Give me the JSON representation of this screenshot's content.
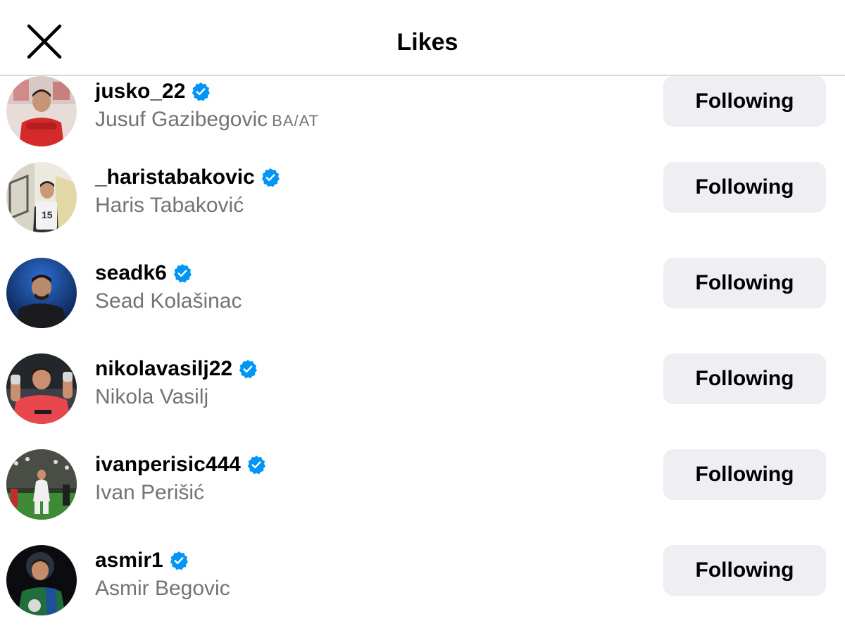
{
  "header": {
    "title": "Likes",
    "close_icon": "close-icon"
  },
  "colors": {
    "verified_badge": "#0095f6",
    "button_bg": "#efeff3",
    "secondary_text": "#737373",
    "divider": "#dbdbdb"
  },
  "users": [
    {
      "username": "jusko_22",
      "full_name": "Jusuf Gazibegovic",
      "full_name_tag": "BA/AT",
      "verified": true,
      "button_label": "Following",
      "avatar_icon": "avatar-player-red-kit"
    },
    {
      "username": "_haristabakovic",
      "full_name": "Haris Tabaković",
      "full_name_tag": "",
      "verified": true,
      "button_label": "Following",
      "avatar_icon": "avatar-player-holding-jersey"
    },
    {
      "username": "seadk6",
      "full_name": "Sead Kolašinac",
      "full_name_tag": "",
      "verified": true,
      "button_label": "Following",
      "avatar_icon": "avatar-player-blue-background"
    },
    {
      "username": "nikolavasilj22",
      "full_name": "Nikola Vasilj",
      "full_name_tag": "",
      "verified": true,
      "button_label": "Following",
      "avatar_icon": "avatar-goalkeeper-applauding"
    },
    {
      "username": "ivanperisic444",
      "full_name": "Ivan Perišić",
      "full_name_tag": "",
      "verified": true,
      "button_label": "Following",
      "avatar_icon": "avatar-player-on-pitch"
    },
    {
      "username": "asmir1",
      "full_name": "Asmir Begovic",
      "full_name_tag": "",
      "verified": true,
      "button_label": "Following",
      "avatar_icon": "avatar-goalkeeper-dark-background"
    }
  ]
}
